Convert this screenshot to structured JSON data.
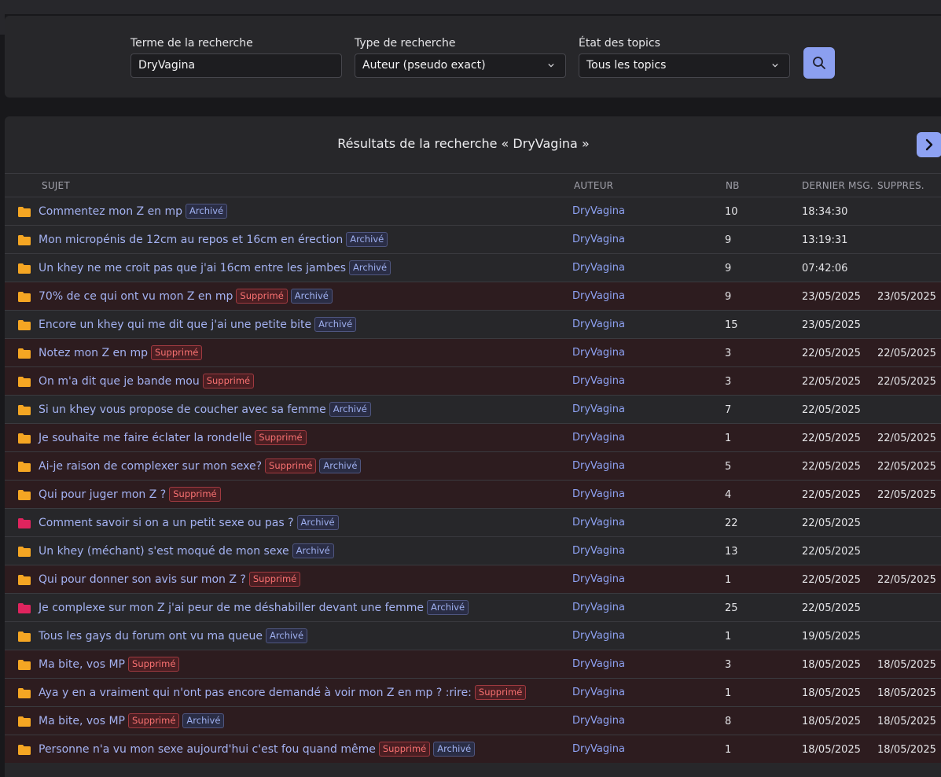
{
  "search": {
    "term_label": "Terme de la recherche",
    "term_value": "DryVagina",
    "type_label": "Type de recherche",
    "type_value": "Auteur (pseudo exact)",
    "state_label": "État des topics",
    "state_value": "Tous les topics",
    "button_icon": "search-icon"
  },
  "results": {
    "title": "Résultats de la recherche « DryVagina »",
    "next_icon": "chevron-right-icon",
    "columns": {
      "subject": "SUJET",
      "author": "AUTEUR",
      "nb": "NB",
      "last": "DERNIER MSG.",
      "deleted": "SUPPRES."
    },
    "badge_deleted": "Supprimé",
    "badge_archived": "Archivé",
    "colors": {
      "folder_normal": "#f5a623",
      "folder_hot": "#e0245e",
      "link": "#a4b2f2",
      "deleted_row": "#2d1c1f",
      "accent": "#8ea2f3"
    },
    "rows": [
      {
        "title": "Commentez mon Z en mp",
        "supprime": false,
        "archive": true,
        "author": "DryVagina",
        "nb": "10",
        "last": "18:34:30",
        "deleted_date": "",
        "hot": false
      },
      {
        "title": "Mon micropénis de 12cm au repos et 16cm en érection",
        "supprime": false,
        "archive": true,
        "author": "DryVagina",
        "nb": "9",
        "last": "13:19:31",
        "deleted_date": "",
        "hot": false
      },
      {
        "title": "Un khey ne me croit pas que j'ai 16cm entre les jambes",
        "supprime": false,
        "archive": true,
        "author": "DryVagina",
        "nb": "9",
        "last": "07:42:06",
        "deleted_date": "",
        "hot": false
      },
      {
        "title": "70% de ce qui ont vu mon Z en mp",
        "supprime": true,
        "archive": true,
        "author": "DryVagina",
        "nb": "9",
        "last": "23/05/2025",
        "deleted_date": "23/05/2025",
        "hot": false
      },
      {
        "title": "Encore un khey qui me dit que j'ai une petite bite",
        "supprime": false,
        "archive": true,
        "author": "DryVagina",
        "nb": "15",
        "last": "23/05/2025",
        "deleted_date": "",
        "hot": false
      },
      {
        "title": "Notez mon Z en mp",
        "supprime": true,
        "archive": false,
        "author": "DryVagina",
        "nb": "3",
        "last": "22/05/2025",
        "deleted_date": "22/05/2025",
        "hot": false
      },
      {
        "title": "On m'a dit que je bande mou",
        "supprime": true,
        "archive": false,
        "author": "DryVagina",
        "nb": "3",
        "last": "22/05/2025",
        "deleted_date": "22/05/2025",
        "hot": false
      },
      {
        "title": "Si un khey vous propose de coucher avec sa femme",
        "supprime": false,
        "archive": true,
        "author": "DryVagina",
        "nb": "7",
        "last": "22/05/2025",
        "deleted_date": "",
        "hot": false
      },
      {
        "title": "Je souhaite me faire éclater la rondelle",
        "supprime": true,
        "archive": false,
        "author": "DryVagina",
        "nb": "1",
        "last": "22/05/2025",
        "deleted_date": "22/05/2025",
        "hot": false
      },
      {
        "title": "Ai-je raison de complexer sur mon sexe?",
        "supprime": true,
        "archive": true,
        "author": "DryVagina",
        "nb": "5",
        "last": "22/05/2025",
        "deleted_date": "22/05/2025",
        "hot": false
      },
      {
        "title": "Qui pour juger mon Z ?",
        "supprime": true,
        "archive": false,
        "author": "DryVagina",
        "nb": "4",
        "last": "22/05/2025",
        "deleted_date": "22/05/2025",
        "hot": false
      },
      {
        "title": "Comment savoir si on a un petit sexe ou pas ?",
        "supprime": false,
        "archive": true,
        "author": "DryVagina",
        "nb": "22",
        "last": "22/05/2025",
        "deleted_date": "",
        "hot": true
      },
      {
        "title": "Un khey (méchant) s'est moqué de mon sexe",
        "supprime": false,
        "archive": true,
        "author": "DryVagina",
        "nb": "13",
        "last": "22/05/2025",
        "deleted_date": "",
        "hot": false
      },
      {
        "title": "Qui pour donner son avis sur mon Z ?",
        "supprime": true,
        "archive": false,
        "author": "DryVagina",
        "nb": "1",
        "last": "22/05/2025",
        "deleted_date": "22/05/2025",
        "hot": false
      },
      {
        "title": "Je complexe sur mon Z j'ai peur de me déshabiller devant une femme",
        "supprime": false,
        "archive": true,
        "author": "DryVagina",
        "nb": "25",
        "last": "22/05/2025",
        "deleted_date": "",
        "hot": true
      },
      {
        "title": "Tous les gays du forum ont vu ma queue",
        "supprime": false,
        "archive": true,
        "author": "DryVagina",
        "nb": "1",
        "last": "19/05/2025",
        "deleted_date": "",
        "hot": false
      },
      {
        "title": "Ma bite, vos MP",
        "supprime": true,
        "archive": false,
        "author": "DryVagina",
        "nb": "3",
        "last": "18/05/2025",
        "deleted_date": "18/05/2025",
        "hot": false
      },
      {
        "title": "Aya y en a vraiment qui n'ont pas encore demandé à voir mon Z en mp ? :rire:",
        "supprime": true,
        "archive": false,
        "author": "DryVagina",
        "nb": "1",
        "last": "18/05/2025",
        "deleted_date": "18/05/2025",
        "hot": false
      },
      {
        "title": "Ma bite, vos MP",
        "supprime": true,
        "archive": true,
        "author": "DryVagina",
        "nb": "8",
        "last": "18/05/2025",
        "deleted_date": "18/05/2025",
        "hot": false
      },
      {
        "title": "Personne n'a vu mon sexe aujourd'hui c'est fou quand même",
        "supprime": true,
        "archive": true,
        "author": "DryVagina",
        "nb": "1",
        "last": "18/05/2025",
        "deleted_date": "18/05/2025",
        "hot": false
      }
    ]
  }
}
